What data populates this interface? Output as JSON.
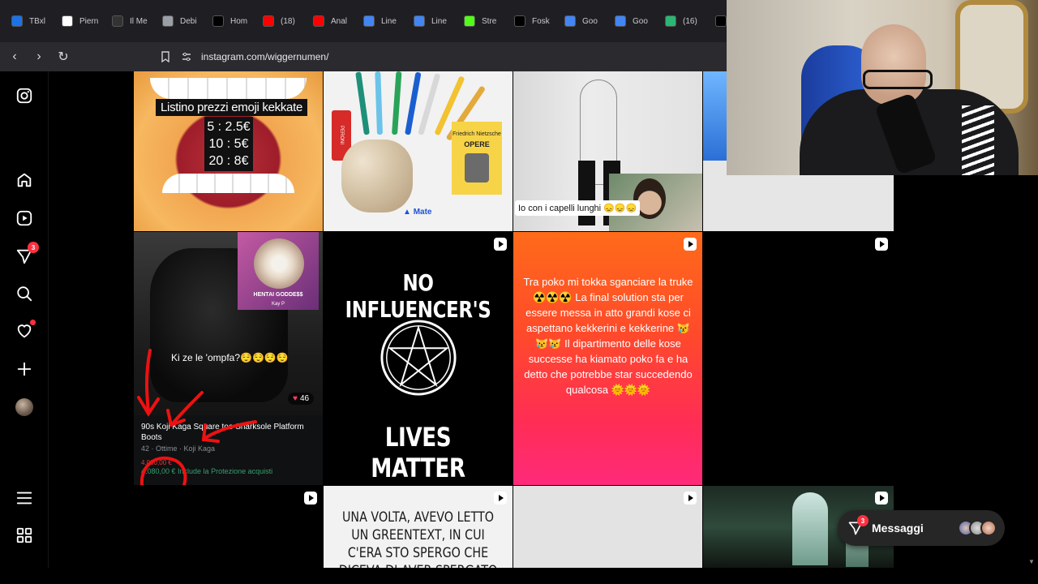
{
  "browser": {
    "tabs": [
      {
        "label": "TBxl",
        "icon": "drive-icon",
        "color": "#1a73e8"
      },
      {
        "label": "Piern",
        "icon": "wikipedia-icon",
        "color": "#ffffff"
      },
      {
        "label": "Il Me",
        "icon": "medium-icon",
        "color": "#333333"
      },
      {
        "label": "Debi",
        "icon": "openai-icon",
        "color": "#9aa0a6"
      },
      {
        "label": "Hom",
        "icon": "x-icon",
        "color": "#000000"
      },
      {
        "label": "(18)",
        "icon": "youtube-icon",
        "color": "#ff0000"
      },
      {
        "label": "Anal",
        "icon": "youtube-icon",
        "color": "#ff0000"
      },
      {
        "label": "Line",
        "icon": "google-icon",
        "color": "#4285f4"
      },
      {
        "label": "Line",
        "icon": "google-icon",
        "color": "#4285f4"
      },
      {
        "label": "Stre",
        "icon": "kick-icon",
        "color": "#53fc18"
      },
      {
        "label": "Fosk",
        "icon": "x-icon",
        "color": "#000000"
      },
      {
        "label": "Goo",
        "icon": "calendar-icon",
        "color": "#4285f4"
      },
      {
        "label": "Goo",
        "icon": "calendar-icon",
        "color": "#4285f4"
      },
      {
        "label": "(16)",
        "icon": "chat-icon",
        "color": "#2bb673"
      },
      {
        "label": "",
        "icon": "tiktok-icon",
        "color": "#000000"
      }
    ],
    "url": "instagram.com/wiggernumen/"
  },
  "rail": {
    "notifications_count": "3"
  },
  "posts": {
    "p1": {
      "caption": "Listino prezzi emoji kekkate",
      "prices": [
        "5 : 2.5€",
        "10 : 5€",
        "20 : 8€"
      ]
    },
    "p2": {
      "beer": "PERONI",
      "book_author": "Friedrich Nietzsche",
      "book_title": "OPERE",
      "brand": "Mate"
    },
    "p3": {
      "caption": "Io con i capelli lunghi 😞😞😞"
    },
    "p5": {
      "cd_title": "HENTAI GODDE$$",
      "cd_artist": "Kay P",
      "caption": "Ki ze le 'ompfa?😌😌😌😌",
      "likes": "46",
      "listing_title": "90s Koji Kaga Square toe Sharksole Platform Boots",
      "listing_sub": "42 · Ottime · Koji Kaga",
      "price": "4.000,00 €",
      "price_total": "4.080,00 € Include la Protezione acquisti"
    },
    "p6": {
      "line1": "NO INFLUENCER'S",
      "line2": "LIVES MATTER"
    },
    "p7": {
      "text": "Tra poko mi tokka sganciare la truke ☢️☢️☢️ La final solution sta per essere messa in atto grandi kose ci aspettano kekkerini e kekkerine 😿😿😿 Il dipartimento delle kose successe ha kiamato poko fa e ha detto che potrebbe star succedendo qualcosa 🌞🌞🌞"
    },
    "p10": {
      "text": "UNA VOLTA, AVEVO LETTO UN GREENTEXT, IN CUI C'ERA STO SPERGO CHE DICEVA DI AVER SPERGATO OUT IN PUBBLICO"
    }
  },
  "messages": {
    "label": "Messaggi",
    "count": "3"
  },
  "colors": {
    "accent": "#ff3040",
    "background": "#000000"
  }
}
